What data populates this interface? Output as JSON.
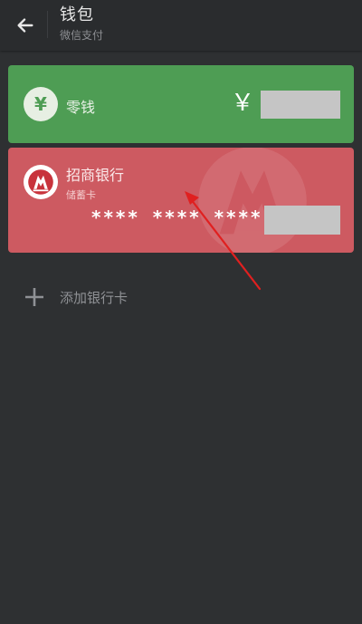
{
  "header": {
    "title": "钱包",
    "subtitle": "微信支付",
    "back_icon": "arrow-left-icon"
  },
  "change_card": {
    "label": "零钱",
    "icon_glyph": "¥",
    "currency_symbol": "￥",
    "color": "#4e9d54"
  },
  "bank_card": {
    "bank_name": "招商银行",
    "card_type": "储蓄卡",
    "masked_number": "**** **** ****",
    "color": "#cd5a61",
    "icon": "cmb-bank-logo-icon"
  },
  "add_card": {
    "label": "添加银行卡",
    "icon": "plus-icon"
  },
  "annotation": {
    "color": "#e02020"
  }
}
